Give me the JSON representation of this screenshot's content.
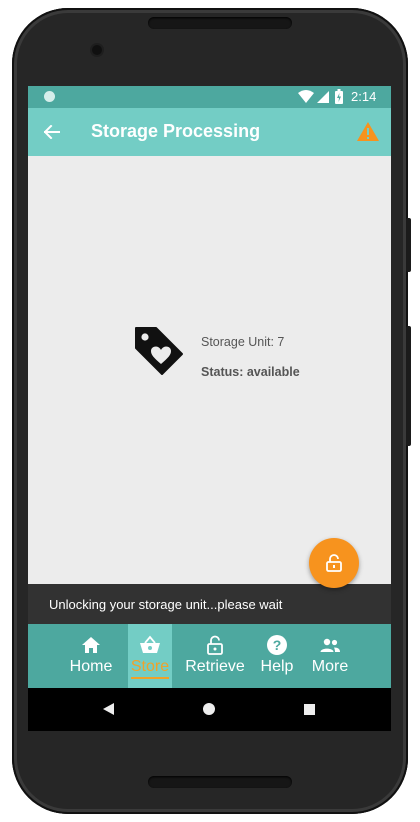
{
  "status_bar": {
    "time": "2:14"
  },
  "app_bar": {
    "title": "Storage Processing"
  },
  "unit": {
    "label": "Storage Unit: 7",
    "status": "Status: available"
  },
  "snackbar": {
    "message": "Unlocking your storage unit...please wait"
  },
  "bottom_nav": {
    "items": [
      {
        "label": "Home",
        "icon": "home-icon"
      },
      {
        "label": "Store",
        "icon": "basket-icon",
        "active": true
      },
      {
        "label": "Retrieve",
        "icon": "lock-open-icon"
      },
      {
        "label": "Help",
        "icon": "help-icon"
      },
      {
        "label": "More",
        "icon": "people-icon"
      }
    ]
  },
  "colors": {
    "status_bar": "#4da89f",
    "app_bar": "#73cdc5",
    "active_tab": "#f0a22a",
    "fab": "#f7931e",
    "warning": "#f7931e"
  }
}
